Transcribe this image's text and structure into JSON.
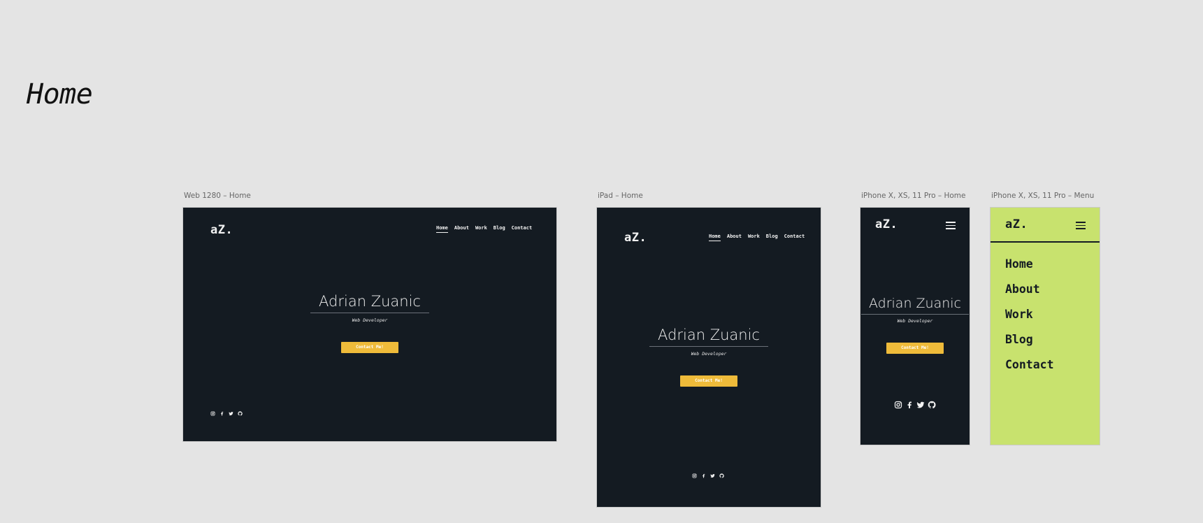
{
  "page": {
    "title": "Home"
  },
  "frames": {
    "web": {
      "label": "Web 1280 – Home"
    },
    "ipad": {
      "label": "iPad – Home"
    },
    "iphone": {
      "label": "iPhone X, XS, 11 Pro – Home"
    },
    "menu": {
      "label": "iPhone X, XS, 11 Pro – Menu"
    }
  },
  "site": {
    "logo": "aZ.",
    "nav": [
      "Home",
      "About",
      "Work",
      "Blog",
      "Contact"
    ],
    "active_nav": "Home",
    "name": "Adrian Zuanic",
    "role": "Web Developer",
    "cta": "Contact Me!",
    "socials": [
      "instagram-icon",
      "facebook-icon",
      "twitter-icon",
      "github-icon"
    ]
  },
  "menu": {
    "items": [
      "Home",
      "About",
      "Work",
      "Blog",
      "Contact"
    ]
  },
  "colors": {
    "canvas": "#e4e4e4",
    "frame_bg": "#141b22",
    "accent": "#efbb3a",
    "menu_bg": "#c8e26e",
    "text_light": "#f2f2f2"
  }
}
